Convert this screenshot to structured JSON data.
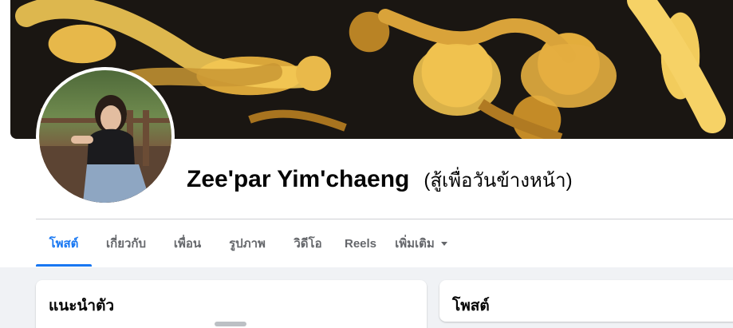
{
  "profile": {
    "name": "Zee'par Yim'chaeng",
    "alternate_name": "(สู้เพื่อวันข้างหน้า)"
  },
  "tabs": [
    {
      "label": "โพสต์",
      "active": true
    },
    {
      "label": "เกี่ยวกับ",
      "active": false
    },
    {
      "label": "เพื่อน",
      "active": false
    },
    {
      "label": "รูปภาพ",
      "active": false
    },
    {
      "label": "วิดีโอ",
      "active": false
    },
    {
      "label": "Reels",
      "active": false
    },
    {
      "label": "เพิ่มเติม",
      "active": false,
      "icon": "caret-down-icon"
    }
  ],
  "intro_card": {
    "title": "แนะนำตัว"
  },
  "posts_card": {
    "title": "โพสต์"
  },
  "colors": {
    "accent": "#1877f2",
    "tab_text": "#65676b",
    "page_bg": "#f0f2f5",
    "text": "#050505"
  }
}
